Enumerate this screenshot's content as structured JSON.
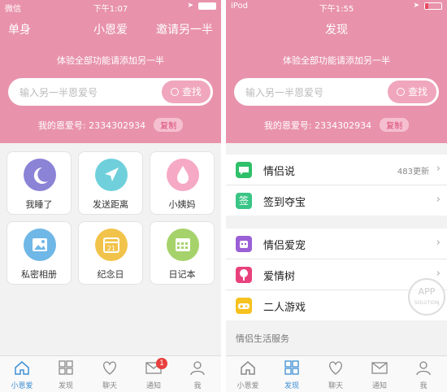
{
  "left": {
    "status": {
      "carrier": "微信",
      "time": "下午1:07"
    },
    "nav": {
      "left": "单身",
      "title": "小恩爱",
      "right": "邀请另一半"
    },
    "hint": "体验全部功能请添加另一半",
    "search": {
      "placeholder": "输入另一半恩爱号",
      "button": "查找"
    },
    "id_label": "我的恩爱号: 2334302934",
    "copy_label": "复制",
    "grid": [
      {
        "label": "我睡了",
        "icon": "moon-icon",
        "color": "#8b83d6"
      },
      {
        "label": "发送距离",
        "icon": "location-arrow-icon",
        "color": "#6fd0dc"
      },
      {
        "label": "小姨妈",
        "icon": "drop-icon",
        "color": "#f6a9c4"
      },
      {
        "label": "私密相册",
        "icon": "photo-icon",
        "color": "#6fb7e6"
      },
      {
        "label": "纪念日",
        "icon": "calendar-icon",
        "color": "#f2c34b"
      },
      {
        "label": "日记本",
        "icon": "diary-icon",
        "color": "#a6d26b"
      }
    ],
    "tabs": [
      {
        "label": "小恩爱",
        "icon": "home-icon",
        "active": true
      },
      {
        "label": "发现",
        "icon": "grid-icon"
      },
      {
        "label": "聊天",
        "icon": "heart-icon"
      },
      {
        "label": "通知",
        "icon": "mail-icon",
        "badge": "1"
      },
      {
        "label": "我",
        "icon": "person-icon"
      }
    ]
  },
  "right": {
    "status": {
      "carrier": "iPod",
      "time": "下午1:55"
    },
    "nav": {
      "title": "发现"
    },
    "hint": "体验全部功能请添加另一半",
    "search": {
      "placeholder": "输入另一半恩爱号",
      "button": "查找"
    },
    "id_label": "我的恩爱号: 2334302934",
    "copy_label": "复制",
    "group1": [
      {
        "label": "情侣说",
        "icon": "chat-icon",
        "color": "#2fc06a",
        "meta": "483更新"
      },
      {
        "label": "签到夺宝",
        "icon": "sign-icon",
        "color": "#39c585",
        "glyph": "签"
      }
    ],
    "group2": [
      {
        "label": "情侣爱宠",
        "icon": "pet-icon",
        "color": "#9b5fd6"
      },
      {
        "label": "爱情树",
        "icon": "tree-icon",
        "color": "#e8417c"
      },
      {
        "label": "二人游戏",
        "icon": "gamepad-icon",
        "color": "#f5c21f"
      }
    ],
    "section_label": "情侣生活服务",
    "tabs": [
      {
        "label": "小恩爱",
        "icon": "home-icon"
      },
      {
        "label": "发现",
        "icon": "grid-icon",
        "active": true
      },
      {
        "label": "聊天",
        "icon": "heart-icon"
      },
      {
        "label": "通知",
        "icon": "mail-icon"
      },
      {
        "label": "我",
        "icon": "person-icon"
      }
    ]
  },
  "watermark": {
    "line1": "APP",
    "line2": "SOLUTION"
  },
  "colors": {
    "pink": "#e893ab",
    "active_tab": "#3d8fd5"
  }
}
